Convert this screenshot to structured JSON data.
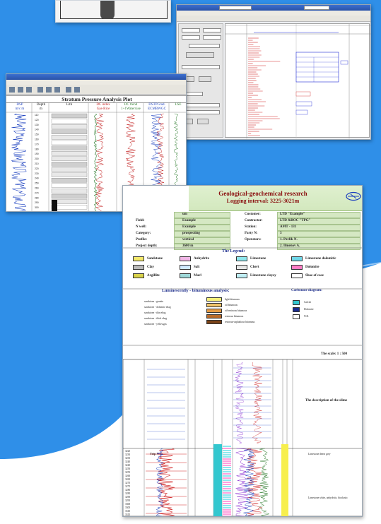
{
  "background": {
    "accent": "#2f8fe8",
    "accent_light": "#5fb2f5"
  },
  "card_top": {
    "label": ""
  },
  "window_right": {
    "title": "",
    "menu": "",
    "fields": [
      "",
      "",
      "",
      ""
    ],
    "buttons": [
      "",
      ""
    ]
  },
  "window_middle": {
    "title_bar": "",
    "menu": "",
    "plot_title": "Stratum Pressure Analysis Plot",
    "columns": [
      {
        "label": "DSP",
        "sub": "m/c m",
        "color": "#1a3fbf"
      },
      {
        "label": "Depth",
        "sub": "m",
        "color": "#111111"
      },
      {
        "label": "Lith",
        "sub": "",
        "color": "#111111"
      },
      {
        "label": "DC index",
        "sub": "Gas-Rice",
        "color": "#c11a1a"
      },
      {
        "label": "DC trend",
        "sub": "1+1Waterxise",
        "color": "#2f7d2f"
      },
      {
        "label": "DSTPGrad.",
        "sub": "ECMBWGC",
        "color": "#1a3fbf"
      },
      {
        "label": "LSE",
        "sub": "",
        "color": "#2f7d2f"
      }
    ],
    "depth_ticks": [
      "110",
      "120",
      "130",
      "140",
      "150",
      "160",
      "170",
      "180",
      "190",
      "200",
      "210",
      "220",
      "230",
      "240",
      "250",
      "260",
      "270",
      "280",
      "290",
      "300"
    ]
  },
  "report": {
    "title": "Geological-geochemical research",
    "subtitle": "Logging interval: 3225-3021m",
    "left_info": [
      {
        "label": "",
        "value": "um"
      },
      {
        "label": "Field:",
        "value": "Example"
      },
      {
        "label": "N well:",
        "value": "Example"
      },
      {
        "label": "Category:",
        "value": "prospecting"
      },
      {
        "label": "Profile:",
        "value": "vertical"
      },
      {
        "label": "Project depth:",
        "value": "3600 m"
      }
    ],
    "right_info": [
      {
        "label": "Customer:",
        "value": "LTD \"Example\""
      },
      {
        "label": "Contractor:",
        "value": "LTD &ROC \"TPG\""
      },
      {
        "label": "Station:",
        "value": "AMT - 131"
      },
      {
        "label": "Party N:",
        "value": "3"
      },
      {
        "label": "Operators:",
        "value": "1. Pavlik N."
      },
      {
        "label": "",
        "value": "2. Ilmenov A."
      }
    ],
    "legend_title": "The Legend:",
    "legend": [
      {
        "name": "Sandstone",
        "color": "#f4e96a"
      },
      {
        "name": "Anhydrite",
        "color": "#f1b6e6"
      },
      {
        "name": "Limestone",
        "color": "#8fe7ee"
      },
      {
        "name": "Limestone dolomitic",
        "color": "#6fd7e8"
      },
      {
        "name": "Clay",
        "color": "#b9b9b9"
      },
      {
        "name": "Salt",
        "color": "#cfe9ff"
      },
      {
        "name": "Chert",
        "color": "#e6e6e6"
      },
      {
        "name": "Dolomite",
        "color": "#ff7cc6"
      },
      {
        "name": "Argillite",
        "color": "#d8d24a"
      },
      {
        "name": "Marl",
        "color": "#9fd9d9"
      },
      {
        "name": "Limestone clayey",
        "color": "#bfeef4"
      },
      {
        "name": "Shoe of case",
        "color": "#ffffff"
      }
    ],
    "lumin_title": "Luminescently - bituminous analysis:",
    "carbonate_title": "Carbonate diagram:",
    "lumin_items": [
      "sandstone - granite",
      "sandstone - dolomite ebag",
      "sandstone - thin ebag",
      "sandstone - thick ebag",
      "sandstone - yellowgas"
    ],
    "bitumen_items": [
      {
        "name": "light bitumous",
        "color": "#f7f07a"
      },
      {
        "name": "oil bitumous",
        "color": "#f2c56a"
      },
      {
        "name": "oil-resinous bitumous",
        "color": "#e39a45"
      },
      {
        "name": "resinous bitumous",
        "color": "#b86a2a"
      },
      {
        "name": "resinous-asphaltous bitumous",
        "color": "#7a4318"
      }
    ],
    "carbonate_items": [
      {
        "name": "Calcite",
        "color": "#33c7cf"
      },
      {
        "name": "Dolomite",
        "color": "#1a2b8f"
      },
      {
        "name": "N.R.",
        "color": "#ffffff"
      }
    ],
    "scale_text": "The scale: 1 : 500",
    "description_title": "The description of the slime",
    "depth_labels": [
      "3225",
      "3230",
      "3235",
      "3240",
      "3245",
      "3250",
      "3255",
      "3260",
      "3265",
      "3270",
      "3275",
      "3280",
      "3285",
      "3290",
      "3295",
      "3300",
      "3305",
      "3310",
      "3315"
    ],
    "trip_label": "Trip N 11",
    "desc_blocks": [
      "Limestone dense grey",
      "Limestone white, anhydritic, bioclastic"
    ]
  }
}
